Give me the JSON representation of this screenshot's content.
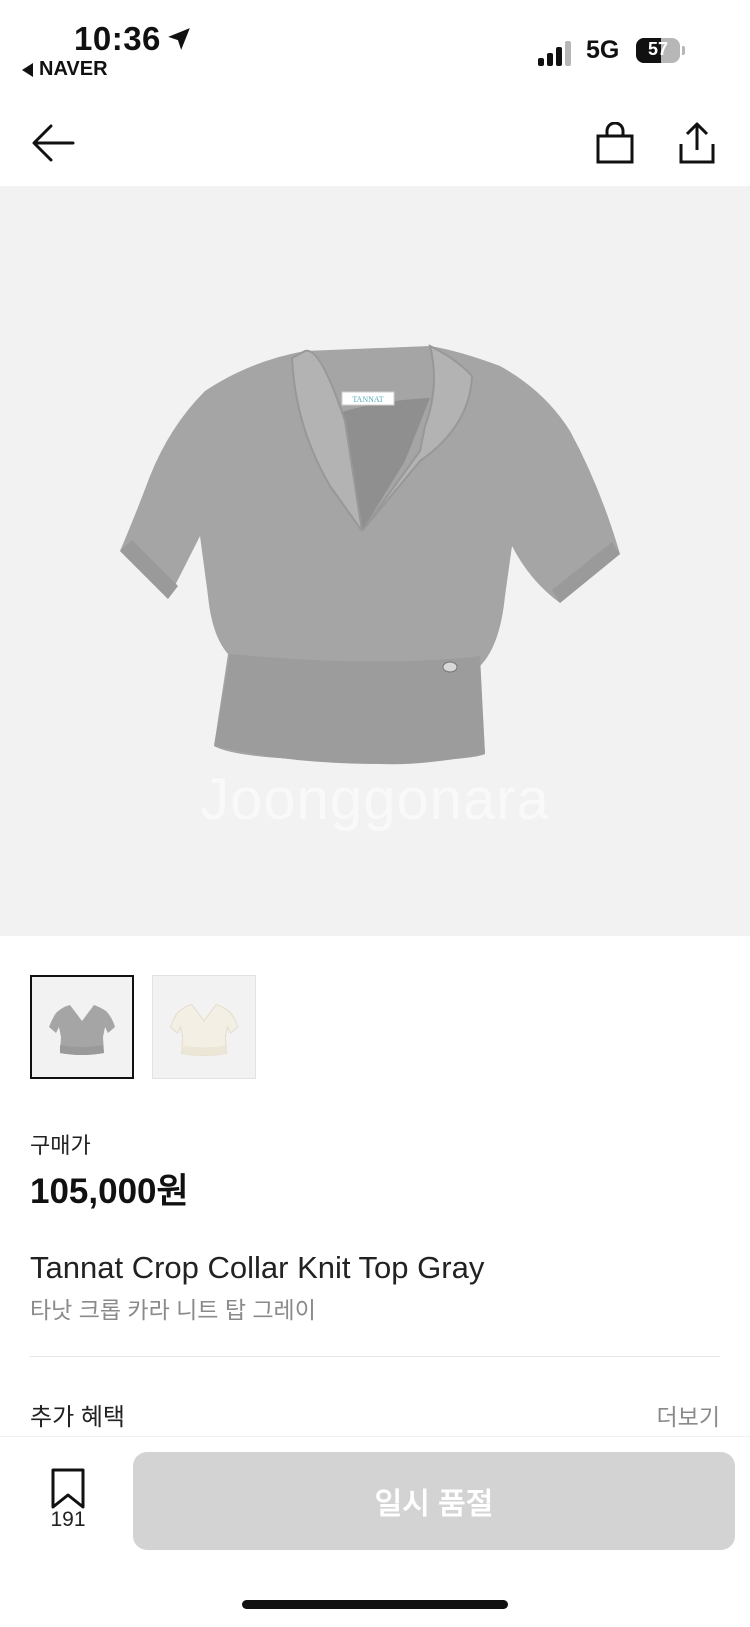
{
  "status_bar": {
    "time": "10:36",
    "back_app": "NAVER",
    "network": "5G",
    "battery_level": "57",
    "battery_fraction": 0.57
  },
  "nav": {
    "back_icon": "arrow-left-icon",
    "bag_icon": "shopping-bag-icon",
    "share_icon": "share-icon"
  },
  "product": {
    "garment_label": "TANNAT",
    "watermark": "Joonggonara",
    "price_label": "구매가",
    "price": "105,000원",
    "name_en": "Tannat Crop Collar Knit Top Gray",
    "name_kr": "타낫 크롭 카라 니트 탑 그레이",
    "thumbnails": [
      {
        "color": "#a5a5a5",
        "selected": true
      },
      {
        "color": "#f3efe4",
        "selected": false
      }
    ]
  },
  "benefit": {
    "label": "추가 혜택",
    "more": "더보기"
  },
  "bottom_bar": {
    "bookmark_icon": "bookmark-icon",
    "bookmark_count": "191",
    "soldout_label": "일시 품절"
  },
  "colors": {
    "hero_bg": "#f2f2f2",
    "knit_gray": "#a5a5a5",
    "button_disabled": "#d3d3d3"
  }
}
